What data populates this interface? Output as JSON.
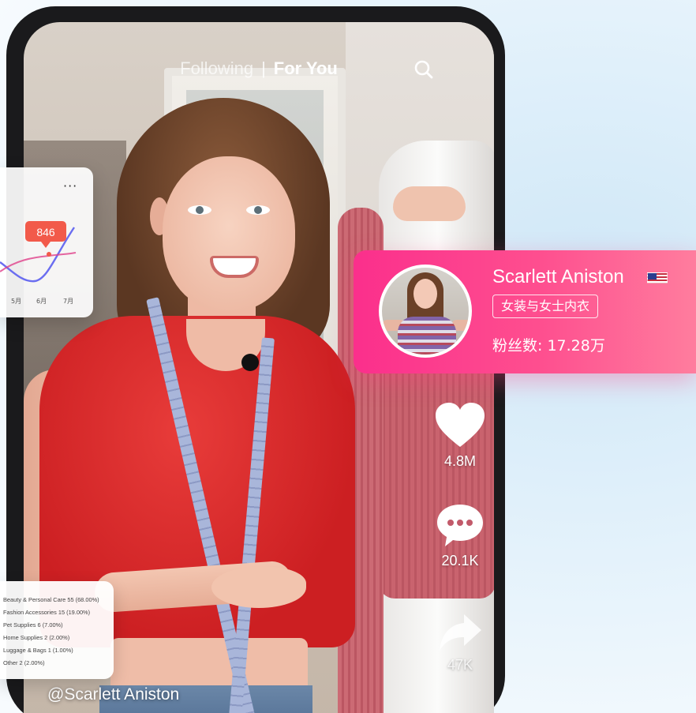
{
  "top_nav": {
    "following_label": "Following",
    "separator": "|",
    "for_you_label": "For You",
    "search_icon": "search-icon"
  },
  "actions": {
    "like_count": "4.8M",
    "comment_count": "20.1K",
    "share_count": "47K",
    "like_icon": "heart-icon",
    "comment_icon": "speech-bubble-icon",
    "share_icon": "share-arrow-icon"
  },
  "video": {
    "username": "@Scarlett Aniston"
  },
  "chart_card": {
    "more_label": "···",
    "badge_value": "846",
    "months": [
      "5月",
      "6月",
      "7月"
    ],
    "accent_color": "#f25a4a"
  },
  "category_card": {
    "rows": [
      "Beauty & Personal Care 55 (68.00%)",
      "Fashion Accessories 15 (19.00%)",
      "Pet Supplies 6 (7.00%)",
      "Home Supplies 2 (2.00%)",
      "Luggage & Bags 1 (1.00%)",
      "Other 2 (2.00%)"
    ]
  },
  "creator": {
    "name": "Scarlett Aniston",
    "flag_icon": "us-flag-icon",
    "category": "女装与女士内衣",
    "fans": "粉丝数: 17.28万",
    "card_color": "#fb2f8c"
  }
}
